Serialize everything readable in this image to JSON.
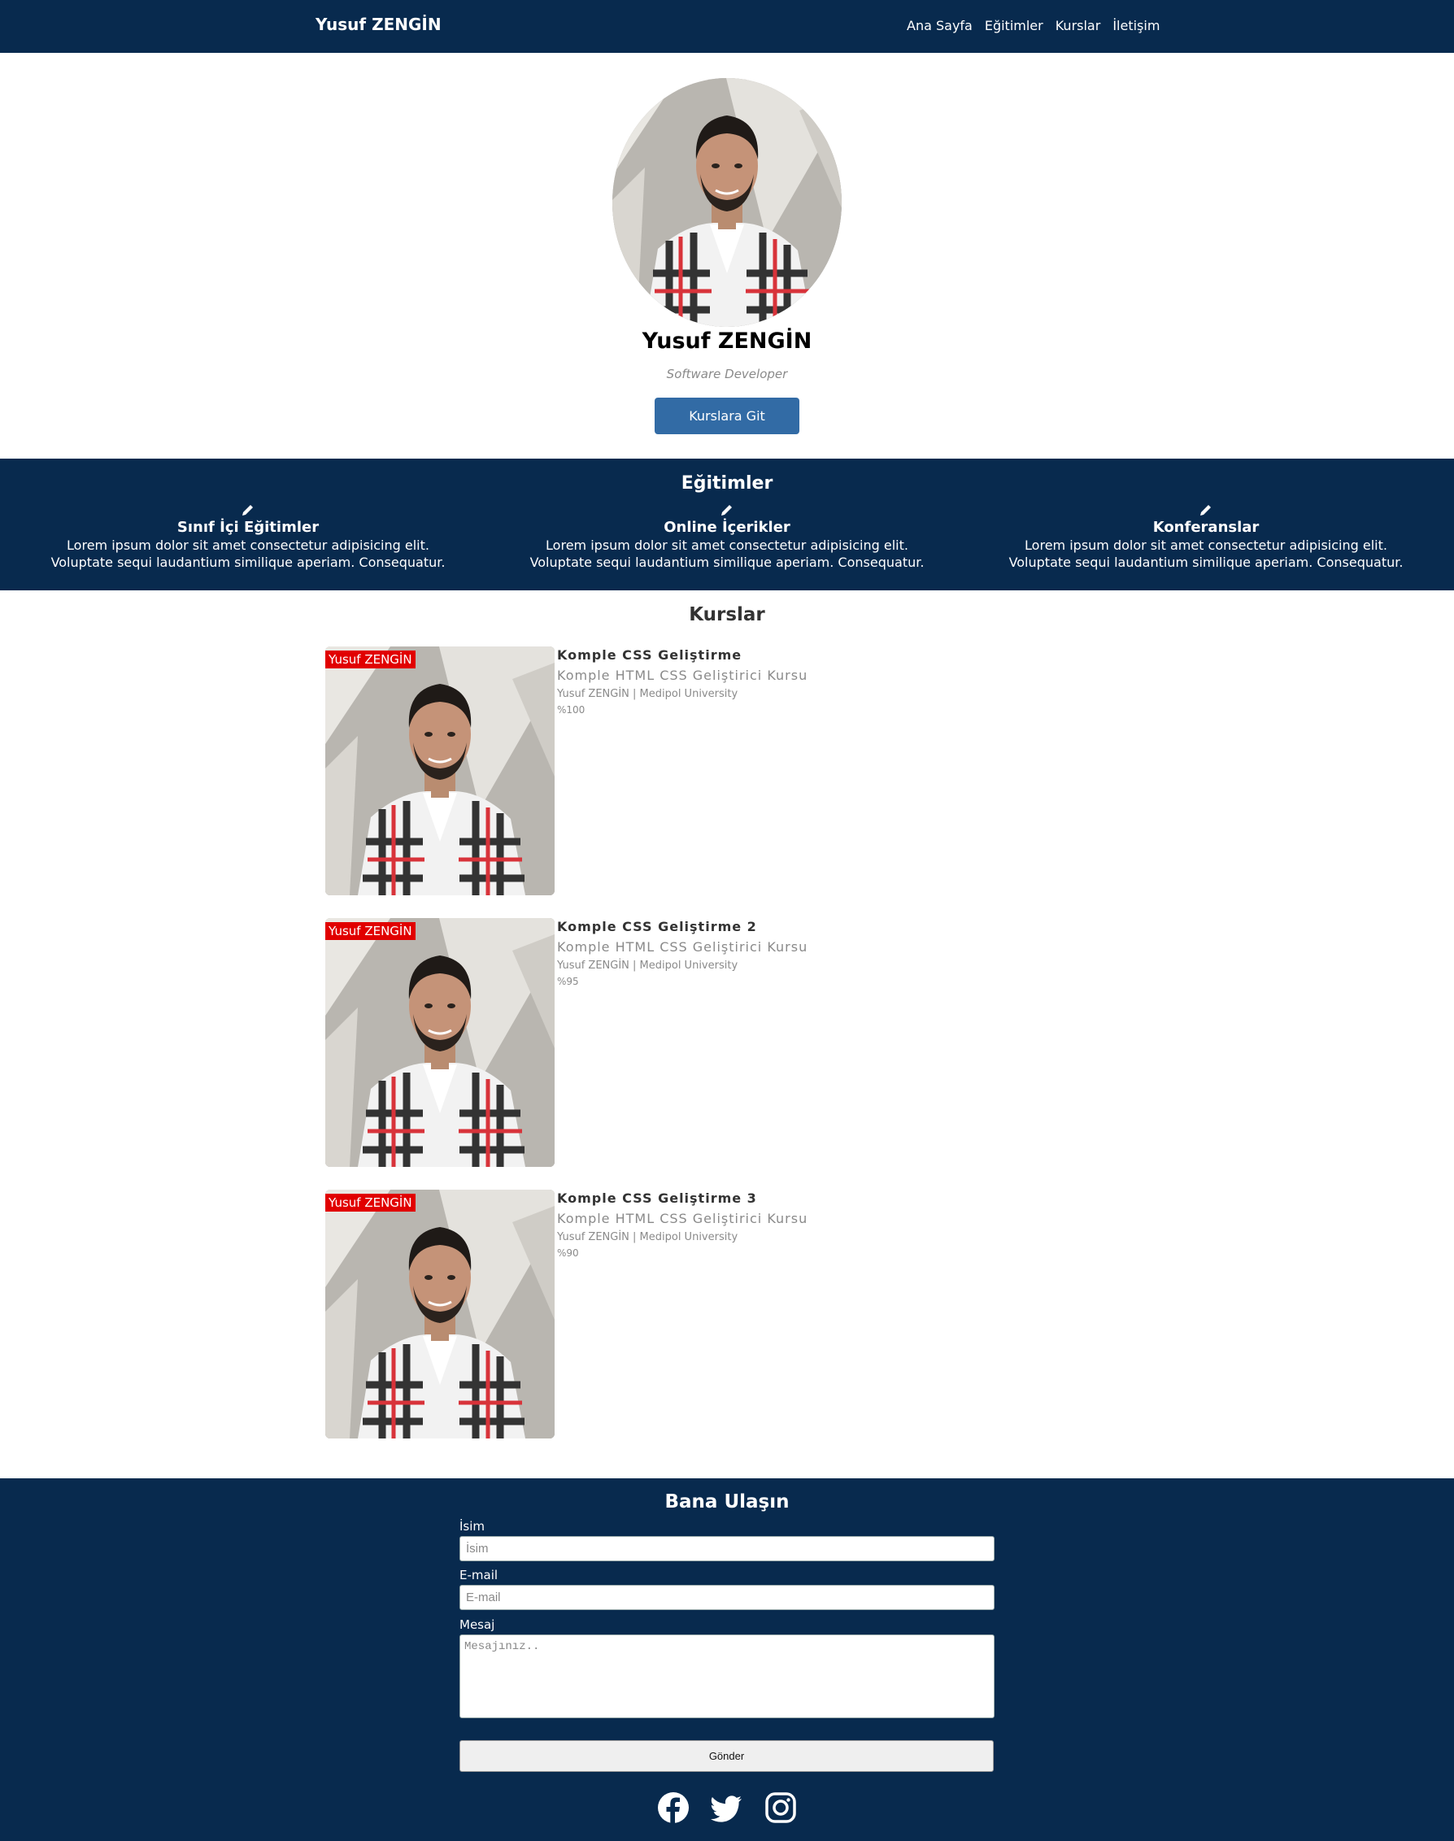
{
  "navbar": {
    "brand": "Yusuf ZENGİN",
    "links": [
      "Ana Sayfa",
      "Eğitimler",
      "Kurslar",
      "İletişim"
    ]
  },
  "hero": {
    "name": "Yusuf ZENGİN",
    "role": "Software Developer",
    "button": "Kurslara Git"
  },
  "trainings": {
    "title": "Eğitimler",
    "items": [
      {
        "icon": "pencil-icon",
        "title": "Sınıf İçi Eğitimler",
        "desc": "Lorem ipsum dolor sit amet consectetur adipisicing elit. Voluptate sequi laudantium similique aperiam. Consequatur."
      },
      {
        "icon": "pencil-icon",
        "title": "Online İçerikler",
        "desc": "Lorem ipsum dolor sit amet consectetur adipisicing elit. Voluptate sequi laudantium similique aperiam. Consequatur."
      },
      {
        "icon": "pencil-icon",
        "title": "Konferanslar",
        "desc": "Lorem ipsum dolor sit amet consectetur adipisicing elit. Voluptate sequi laudantium similique aperiam. Consequatur."
      }
    ]
  },
  "courses": {
    "title": "Kurslar",
    "items": [
      {
        "badge": "Yusuf ZENGİN",
        "title": "Komple CSS Geliştirme",
        "subtitle": "Komple HTML CSS Geliştirici Kursu",
        "meta": "Yusuf ZENGİN | Medipol University",
        "progress": "%100"
      },
      {
        "badge": "Yusuf ZENGİN",
        "title": "Komple CSS Geliştirme 2",
        "subtitle": "Komple HTML CSS Geliştirici Kursu",
        "meta": "Yusuf ZENGİN | Medipol University",
        "progress": "%95"
      },
      {
        "badge": "Yusuf ZENGİN",
        "title": "Komple CSS Geliştirme 3",
        "subtitle": "Komple HTML CSS Geliştirici Kursu",
        "meta": "Yusuf ZENGİN | Medipol University",
        "progress": "%90"
      }
    ]
  },
  "contact": {
    "title": "Bana Ulaşın",
    "name_label": "İsim",
    "name_placeholder": "İsim",
    "email_label": "E-mail",
    "email_placeholder": "E-mail",
    "message_label": "Mesaj",
    "message_placeholder": "Mesajınız..",
    "submit": "Gönder",
    "socials": [
      "facebook-icon",
      "twitter-icon",
      "instagram-icon"
    ]
  },
  "colors": {
    "navy": "#082a4e",
    "button_blue": "#326ba5",
    "badge_red": "#e10000"
  }
}
